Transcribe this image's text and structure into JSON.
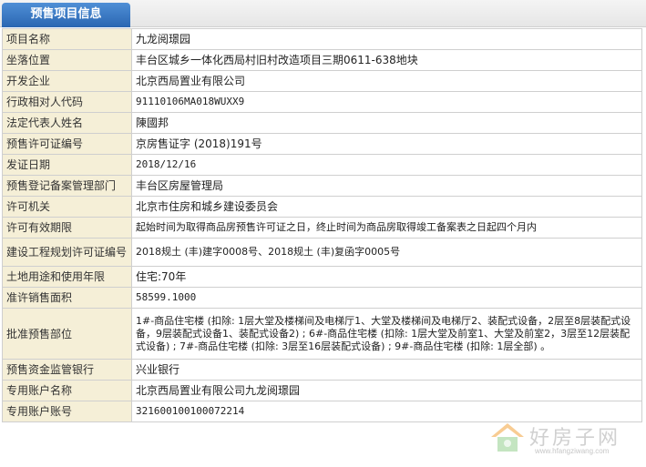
{
  "tab": {
    "title": "预售项目信息"
  },
  "rows": [
    {
      "label": "项目名称",
      "value": "九龙阅璟园"
    },
    {
      "label": "坐落位置",
      "value": "丰台区城乡一体化西局村旧村改造项目三期0611-638地块"
    },
    {
      "label": "开发企业",
      "value": "北京西局置业有限公司"
    },
    {
      "label": "行政相对人代码",
      "value": "91110106MA018WUXX9"
    },
    {
      "label": "法定代表人姓名",
      "value": "陳國邦"
    },
    {
      "label": "预售许可证编号",
      "value": "京房售证字 (2018)191号"
    },
    {
      "label": "发证日期",
      "value": "2018/12/16"
    },
    {
      "label": "预售登记备案管理部门",
      "value": "丰台区房屋管理局"
    },
    {
      "label": "许可机关",
      "value": "北京市住房和城乡建设委员会"
    },
    {
      "label": "许可有效期限",
      "value": "起始时间为取得商品房预售许可证之日，终止时间为商品房取得竣工备案表之日起四个月内"
    },
    {
      "label": "建设工程规划许可证编号",
      "value": "2018规土 (丰)建字0008号、2018规土 (丰)复函字0005号"
    },
    {
      "label": "土地用途和使用年限",
      "value": "住宅:70年"
    },
    {
      "label": "准许销售面积",
      "value": "58599.1000"
    },
    {
      "label": "批准预售部位",
      "value": "1#-商品住宅楼 (扣除: 1层大堂及楼梯间及电梯厅1、大堂及楼梯间及电梯厅2、装配式设备，2层至8层装配式设备，9层装配式设备1、装配式设备2) ; 6#-商品住宅楼 (扣除: 1层大堂及前室1、大堂及前室2，3层至12层装配式设备) ; 7#-商品住宅楼 (扣除: 3层至16层装配式设备) ; 9#-商品住宅楼 (扣除: 1层全部) 。"
    },
    {
      "label": "预售资金监管银行",
      "value": "兴业银行"
    },
    {
      "label": "专用账户名称",
      "value": "北京西局置业有限公司九龙阅璟园"
    },
    {
      "label": "专用账户账号",
      "value": "321600100100072214"
    }
  ],
  "watermark": {
    "text": "好房子网",
    "url": "www.hfangziwang.com",
    "colors": {
      "roof": "#f2a23a",
      "wall": "#7cc576",
      "text": "#aaaaaa"
    }
  }
}
